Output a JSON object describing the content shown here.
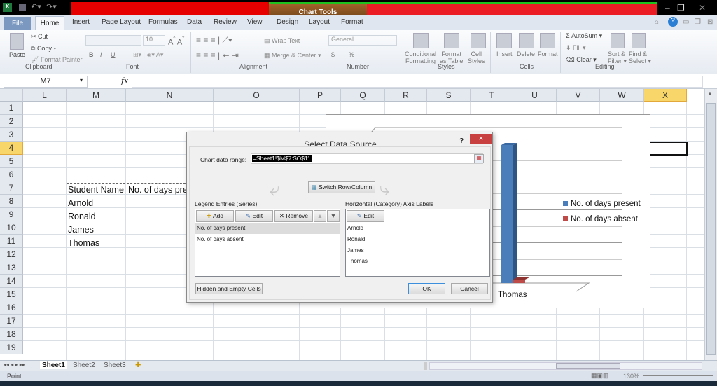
{
  "quick_access": {
    "app_icon": "excel-icon",
    "save": "save-icon",
    "undo": "undo-icon",
    "redo": "redo-icon"
  },
  "context": {
    "chart_tools": "Chart Tools"
  },
  "tabs": [
    "File",
    "Home",
    "Insert",
    "Page Layout",
    "Formulas",
    "Data",
    "Review",
    "View",
    "Design",
    "Layout",
    "Format"
  ],
  "ribbon": {
    "clipboard": {
      "paste": "Paste",
      "cut": "Cut",
      "copy": "Copy",
      "format_painter": "Format Painter",
      "group": "Clipboard"
    },
    "font": {
      "size": "10",
      "group": "Font",
      "bold": "B",
      "italic": "I",
      "underline": "U"
    },
    "alignment": {
      "wrap": "Wrap Text",
      "merge": "Merge & Center",
      "group": "Alignment"
    },
    "number": {
      "format": "General",
      "currency": "$",
      "percent": "%",
      "group": "Number"
    },
    "styles": {
      "conditional": "Conditional",
      "conditional2": "Formatting",
      "format_table": "Format",
      "format_table2": "as Table",
      "cell_styles": "Cell",
      "cell_styles2": "Styles",
      "group": "Styles"
    },
    "cells": {
      "insert": "Insert",
      "delete": "Delete",
      "format": "Format",
      "group": "Cells"
    },
    "editing": {
      "autosum": "AutoSum",
      "fill": "Fill",
      "clear": "Clear",
      "sort": "Sort &",
      "sort2": "Filter",
      "find": "Find &",
      "find2": "Select",
      "group": "Editing"
    }
  },
  "formula_bar": {
    "name_box": "M7",
    "fx": "fx",
    "value": ""
  },
  "columns": [
    "L",
    "M",
    "N",
    "O",
    "P",
    "Q",
    "R",
    "S",
    "T",
    "U",
    "V",
    "W",
    "X"
  ],
  "rows": [
    "1",
    "2",
    "3",
    "4",
    "5",
    "6",
    "7",
    "8",
    "9",
    "10",
    "11",
    "12",
    "13",
    "14",
    "15",
    "16",
    "17",
    "18",
    "19"
  ],
  "cells": {
    "m7": "Student Name",
    "n7": "No. of days present",
    "m8": "Arnold",
    "m9": "Ronald",
    "m10": "James",
    "m11": "Thomas"
  },
  "chart_data": {
    "type": "bar",
    "categories_visible": [
      "Thomas"
    ],
    "series": [
      {
        "name": "No. of days present",
        "color": "#4a7ebb"
      },
      {
        "name": "No. of days absent",
        "color": "#be4b48"
      }
    ],
    "legend": "right"
  },
  "dialog": {
    "title": "Select Data Source",
    "help": "?",
    "close": "×",
    "range_label": "Chart data range:",
    "range_value": "=Sheet1!$M$7:$O$11",
    "switch": "Switch Row/Column",
    "legend_title": "Legend Entries (Series)",
    "add": "Add",
    "edit": "Edit",
    "remove": "Remove",
    "series": [
      "No. of days present",
      "No. of days absent"
    ],
    "axis_title": "Horizontal (Category) Axis Labels",
    "axis_edit": "Edit",
    "categories": [
      "Arnold",
      "Ronald",
      "James",
      "Thomas"
    ],
    "hidden": "Hidden and Empty Cells",
    "ok": "OK",
    "cancel": "Cancel"
  },
  "sheets": [
    "Sheet1",
    "Sheet2",
    "Sheet3"
  ],
  "status": {
    "mode": "Point",
    "zoom": "130%"
  }
}
